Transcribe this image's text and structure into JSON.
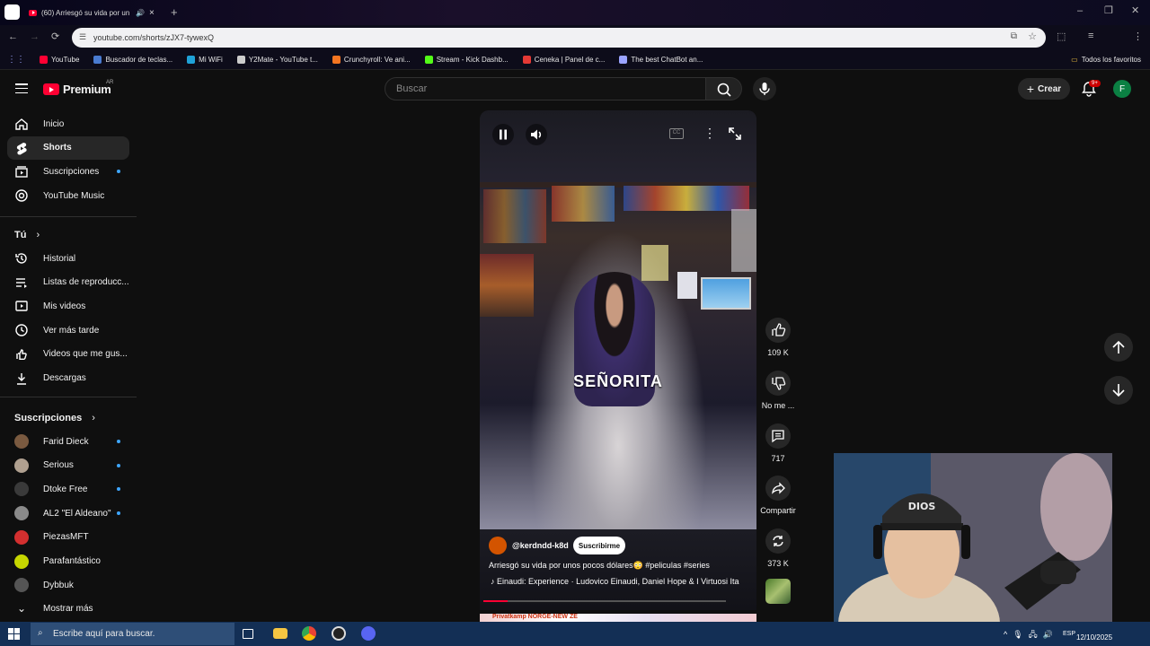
{
  "browser": {
    "tab_title": "(60) Arriesgó su vida por un",
    "url": "youtube.com/shorts/zJX7-tywexQ",
    "bookmarks": [
      {
        "label": "YouTube",
        "color": "#ff0033"
      },
      {
        "label": "Buscador de teclas...",
        "color": "#4a7bd0"
      },
      {
        "label": "Mi WiFi",
        "color": "#1fa2d8"
      },
      {
        "label": "Y2Mate - YouTube t...",
        "color": "#cccccc"
      },
      {
        "label": "Crunchyroll: Ve ani...",
        "color": "#f47521"
      },
      {
        "label": "Stream - Kick Dashb...",
        "color": "#53fc18"
      },
      {
        "label": "Ceneka | Panel de c...",
        "color": "#e53935"
      },
      {
        "label": "The best ChatBot an...",
        "color": "#9aa3ff"
      }
    ],
    "all_bookmarks": "Todos los favoritos"
  },
  "header": {
    "logo": "Premium",
    "region": "AR",
    "search_placeholder": "Buscar",
    "create_label": "Crear",
    "notif_badge": "9+",
    "avatar_letter": "F"
  },
  "sidebar": {
    "main": [
      {
        "label": "Inicio",
        "icon": "home-icon"
      },
      {
        "label": "Shorts",
        "icon": "shorts-icon"
      },
      {
        "label": "Suscripciones",
        "icon": "subscriptions-icon"
      },
      {
        "label": "YouTube Music",
        "icon": "music-icon"
      }
    ],
    "you_heading": "Tú",
    "you_items": [
      {
        "label": "Historial",
        "icon": "history-icon"
      },
      {
        "label": "Listas de reproducc...",
        "icon": "playlist-icon"
      },
      {
        "label": "Mis videos",
        "icon": "my-videos-icon"
      },
      {
        "label": "Ver más tarde",
        "icon": "clock-icon"
      },
      {
        "label": "Videos que me gus...",
        "icon": "like-icon"
      },
      {
        "label": "Descargas",
        "icon": "download-icon"
      }
    ],
    "subs_heading": "Suscripciones",
    "subscriptions": [
      {
        "label": "Farid Dieck",
        "color": "#7a5a40"
      },
      {
        "label": "Serious",
        "color": "#b0a090"
      },
      {
        "label": "Dtoke Free",
        "color": "#3a3a3a"
      },
      {
        "label": "AL2 \"El Aldeano\"",
        "color": "#8a8a8a"
      },
      {
        "label": "PiezasMFT",
        "color": "#d32f2f"
      },
      {
        "label": "Parafantástico",
        "color": "#c6d600"
      },
      {
        "label": "Dybbuk",
        "color": "#555555"
      }
    ],
    "show_more": "Mostrar más"
  },
  "short": {
    "caption": "SEÑORITA",
    "channel": "@kerdndd-k8d",
    "subscribe_label": "Suscribirme",
    "title": "Arriesgó su vida por unos pocos dólares😳 #peliculas #series",
    "music": "Einaudi: Experience · Ludovico Einaudi, Daniel Hope & I Virtuosi Ita",
    "progress": 0.1,
    "next_preview": "Privatkamp NORGE-NEW ZE"
  },
  "actions": {
    "likes": "109 K",
    "dislike": "No me ...",
    "comments": "717",
    "share": "Compartir",
    "remix": "373 K"
  },
  "taskbar": {
    "search_placeholder": "Escribe aquí para buscar.",
    "lang": "ESP",
    "date": "12/10/2025"
  }
}
